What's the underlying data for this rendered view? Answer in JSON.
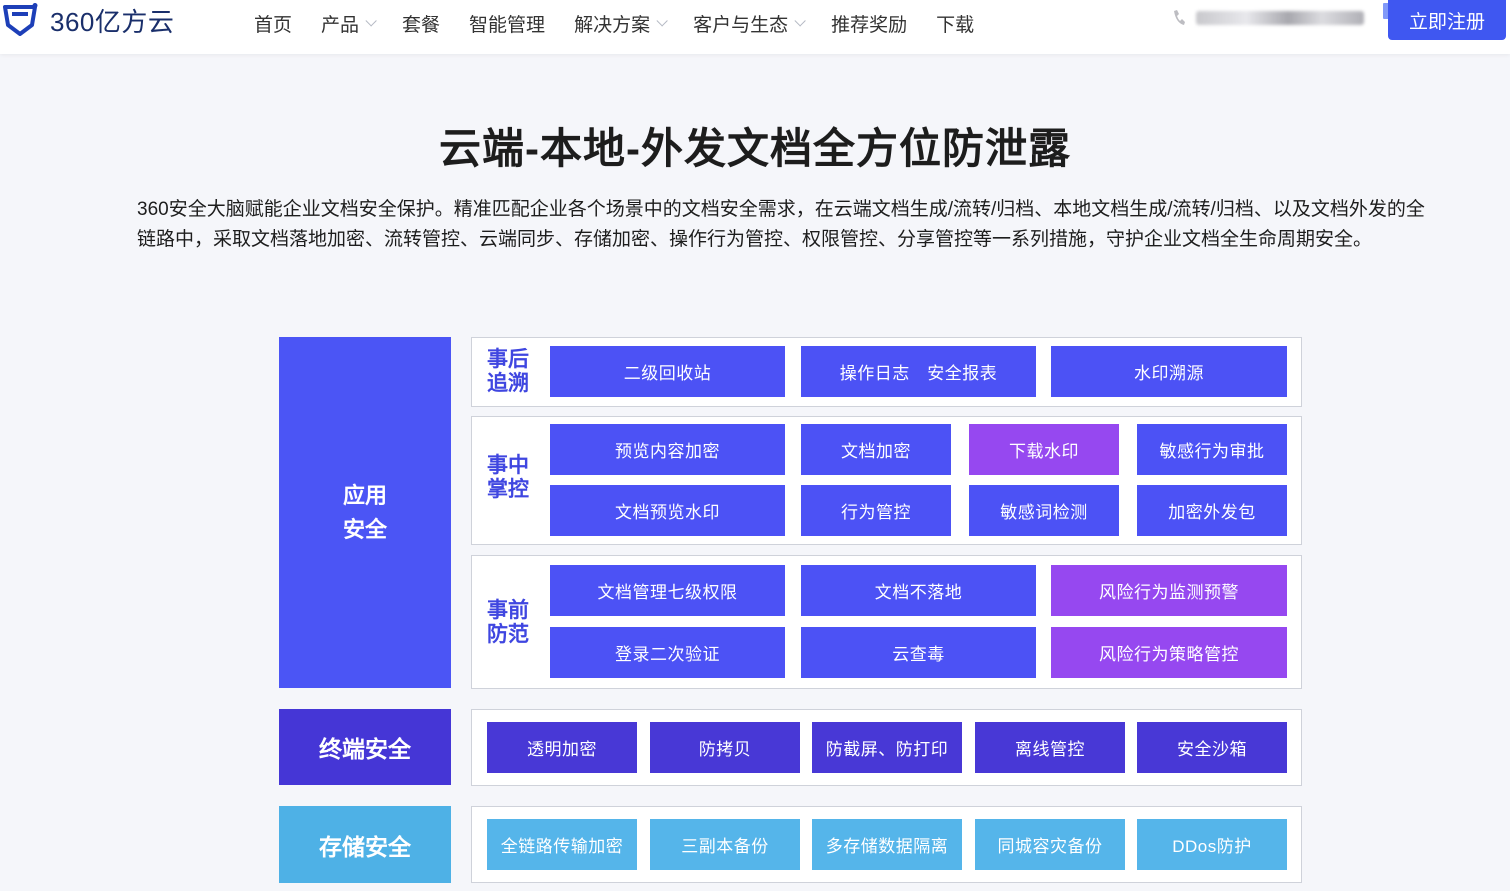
{
  "header": {
    "logo_text": "360亿方云",
    "nav": [
      {
        "label": "首页",
        "has_dropdown": false
      },
      {
        "label": "产品",
        "has_dropdown": true
      },
      {
        "label": "套餐",
        "has_dropdown": false
      },
      {
        "label": "智能管理",
        "has_dropdown": false
      },
      {
        "label": "解决方案",
        "has_dropdown": true
      },
      {
        "label": "客户与生态",
        "has_dropdown": true
      },
      {
        "label": "推荐奖励",
        "has_dropdown": false
      },
      {
        "label": "下载",
        "has_dropdown": false
      }
    ],
    "register_label": "立即注册"
  },
  "main": {
    "title": "云端-本地-外发文档全方位防泄露",
    "description": "360安全大脑赋能企业文档安全保护。精准匹配企业各个场景中的文档安全需求，在云端文档生成/流转/归档、本地文档生成/流转/归档、以及文档外发的全链路中，采取文档落地加密、流转管控、云端同步、存储加密、操作行为管控、权限管控、分享管控等一系列措施，守护企业文档全生命周期安全。"
  },
  "diagram": {
    "app_security": {
      "label_line1": "应用",
      "label_line2": "安全",
      "after": {
        "label_line1": "事后",
        "label_line2": "追溯",
        "items": [
          "二级回收站",
          "操作日志　安全报表",
          "水印溯源"
        ]
      },
      "during": {
        "label_line1": "事中",
        "label_line2": "掌控",
        "items": [
          "预览内容加密",
          "文档加密",
          "下载水印",
          "敏感行为审批",
          "文档预览水印",
          "行为管控",
          "敏感词检测",
          "加密外发包"
        ]
      },
      "before": {
        "label_line1": "事前",
        "label_line2": "防范",
        "items": [
          "文档管理七级权限",
          "文档不落地",
          "风险行为监测预警",
          "登录二次验证",
          "云查毒",
          "风险行为策略管控"
        ]
      }
    },
    "terminal_security": {
      "label": "终端安全",
      "items": [
        "透明加密",
        "防拷贝",
        "防截屏、防打印",
        "离线管控",
        "安全沙箱"
      ]
    },
    "storage_security": {
      "label": "存储安全",
      "items": [
        "全链路传输加密",
        "三副本备份",
        "多存储数据隔离",
        "同城容灾备份",
        "DDos防护"
      ]
    }
  },
  "colors": {
    "primary_blue": "#4c52f5",
    "highlight_purple": "#9648f0",
    "terminal_dark": "#4838d6",
    "storage_sky": "#55b5ea",
    "register_button": "#3f57f1"
  }
}
